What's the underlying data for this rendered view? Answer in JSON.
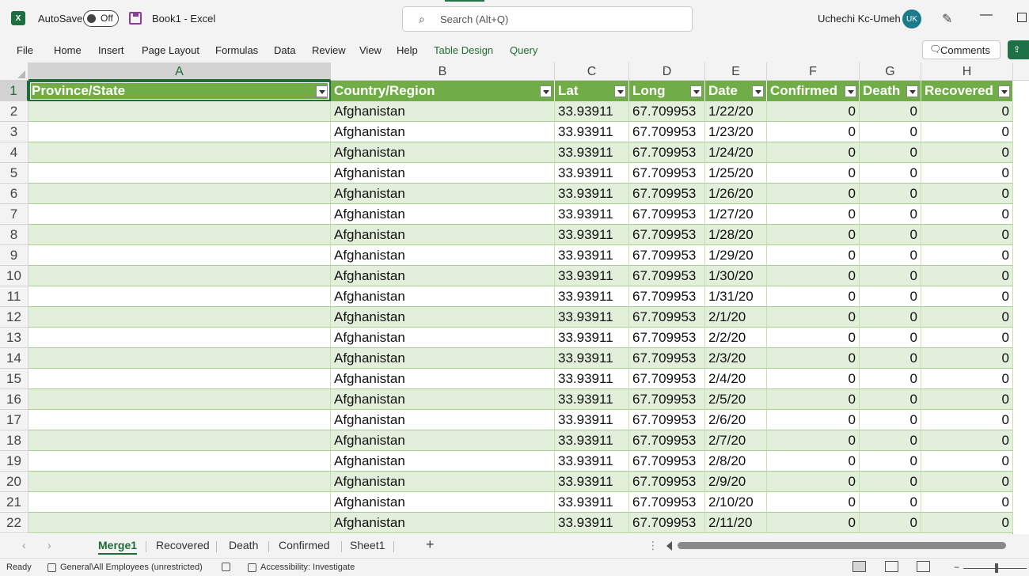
{
  "titlebar": {
    "app_icon": "excel-logo-icon",
    "autosave_label": "AutoSave",
    "autosave_state": "Off",
    "document_title": "Book1  -  Excel",
    "search_placeholder": "Search (Alt+Q)",
    "user_name": "Uchechi Kc-Umeh",
    "user_initials": "UK",
    "min_glyph": "—"
  },
  "ribbon": {
    "tabs": [
      "File",
      "Home",
      "Insert",
      "Page Layout",
      "Formulas",
      "Data",
      "Review",
      "View",
      "Help",
      "Table Design",
      "Query"
    ],
    "comments_label": "Comments"
  },
  "sheet": {
    "column_letters": [
      "A",
      "B",
      "C",
      "D",
      "E",
      "F",
      "G",
      "H"
    ],
    "headers": [
      "Province/State",
      "Country/Region",
      "Lat",
      "Long",
      "Date",
      "Confirmed",
      "Death",
      "Recovered"
    ],
    "rows": [
      [
        "",
        "Afghanistan",
        "33.93911",
        "67.709953",
        "1/22/20",
        "0",
        "0",
        "0"
      ],
      [
        "",
        "Afghanistan",
        "33.93911",
        "67.709953",
        "1/23/20",
        "0",
        "0",
        "0"
      ],
      [
        "",
        "Afghanistan",
        "33.93911",
        "67.709953",
        "1/24/20",
        "0",
        "0",
        "0"
      ],
      [
        "",
        "Afghanistan",
        "33.93911",
        "67.709953",
        "1/25/20",
        "0",
        "0",
        "0"
      ],
      [
        "",
        "Afghanistan",
        "33.93911",
        "67.709953",
        "1/26/20",
        "0",
        "0",
        "0"
      ],
      [
        "",
        "Afghanistan",
        "33.93911",
        "67.709953",
        "1/27/20",
        "0",
        "0",
        "0"
      ],
      [
        "",
        "Afghanistan",
        "33.93911",
        "67.709953",
        "1/28/20",
        "0",
        "0",
        "0"
      ],
      [
        "",
        "Afghanistan",
        "33.93911",
        "67.709953",
        "1/29/20",
        "0",
        "0",
        "0"
      ],
      [
        "",
        "Afghanistan",
        "33.93911",
        "67.709953",
        "1/30/20",
        "0",
        "0",
        "0"
      ],
      [
        "",
        "Afghanistan",
        "33.93911",
        "67.709953",
        "1/31/20",
        "0",
        "0",
        "0"
      ],
      [
        "",
        "Afghanistan",
        "33.93911",
        "67.709953",
        "2/1/20",
        "0",
        "0",
        "0"
      ],
      [
        "",
        "Afghanistan",
        "33.93911",
        "67.709953",
        "2/2/20",
        "0",
        "0",
        "0"
      ],
      [
        "",
        "Afghanistan",
        "33.93911",
        "67.709953",
        "2/3/20",
        "0",
        "0",
        "0"
      ],
      [
        "",
        "Afghanistan",
        "33.93911",
        "67.709953",
        "2/4/20",
        "0",
        "0",
        "0"
      ],
      [
        "",
        "Afghanistan",
        "33.93911",
        "67.709953",
        "2/5/20",
        "0",
        "0",
        "0"
      ],
      [
        "",
        "Afghanistan",
        "33.93911",
        "67.709953",
        "2/6/20",
        "0",
        "0",
        "0"
      ],
      [
        "",
        "Afghanistan",
        "33.93911",
        "67.709953",
        "2/7/20",
        "0",
        "0",
        "0"
      ],
      [
        "",
        "Afghanistan",
        "33.93911",
        "67.709953",
        "2/8/20",
        "0",
        "0",
        "0"
      ],
      [
        "",
        "Afghanistan",
        "33.93911",
        "67.709953",
        "2/9/20",
        "0",
        "0",
        "0"
      ],
      [
        "",
        "Afghanistan",
        "33.93911",
        "67.709953",
        "2/10/20",
        "0",
        "0",
        "0"
      ],
      [
        "",
        "Afghanistan",
        "33.93911",
        "67.709953",
        "2/11/20",
        "0",
        "0",
        "0"
      ]
    ],
    "row_numbers": [
      "1",
      "2",
      "3",
      "4",
      "5",
      "6",
      "7",
      "8",
      "9",
      "10",
      "11",
      "12",
      "13",
      "14",
      "15",
      "16",
      "17",
      "18",
      "19",
      "20",
      "21",
      "22"
    ],
    "numeric_columns": [
      2,
      3,
      5,
      6,
      7
    ],
    "band_color": "#e2efda",
    "header_color": "#70ad47"
  },
  "sheet_tabs": {
    "tabs": [
      "Merge1",
      "Recovered",
      "Death",
      "Confirmed",
      "Sheet1"
    ],
    "active": "Merge1",
    "add_glyph": "+",
    "prev_glyph": "‹",
    "next_glyph": "›",
    "dots_glyph": "⋮"
  },
  "statusbar": {
    "ready": "Ready",
    "sensitivity": "General\\All Employees (unrestricted)",
    "accessibility": "Accessibility: Investigate",
    "zoom_minus": "−"
  }
}
